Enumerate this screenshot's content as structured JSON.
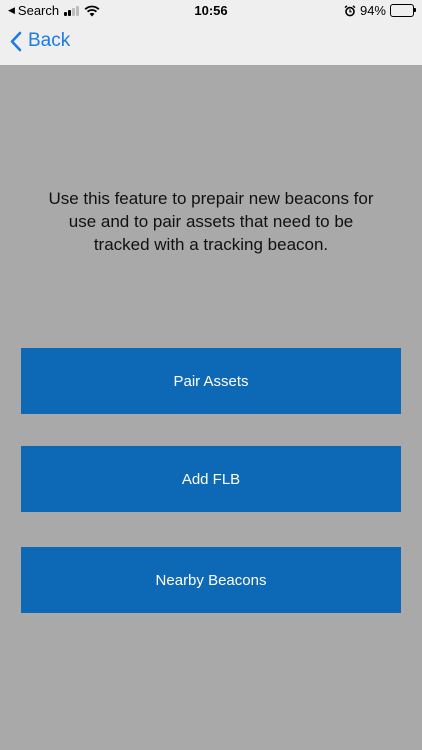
{
  "status_bar": {
    "back_app": "Search",
    "time": "10:56",
    "battery": "94%"
  },
  "nav": {
    "back_label": "Back"
  },
  "main": {
    "description": "Use this feature to prepair new beacons for use and to pair assets that need to be tracked  with a tracking beacon.",
    "buttons": [
      {
        "label": "Pair Assets"
      },
      {
        "label": "Add FLB"
      },
      {
        "label": "Nearby Beacons"
      }
    ]
  },
  "colors": {
    "accent": "#1a7ce6",
    "button_bg": "#0d68b5",
    "background": "#a9a9a9"
  }
}
